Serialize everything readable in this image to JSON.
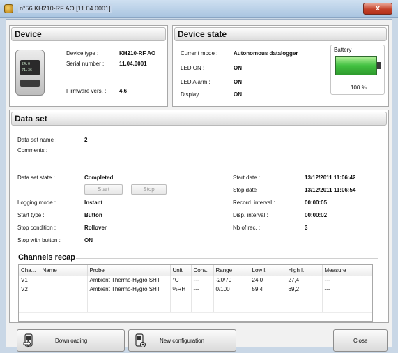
{
  "window": {
    "title": "n°56 KH210-RF AO [11.04.0001]",
    "close_label": "x"
  },
  "device_panel": {
    "heading": "Device",
    "type_label": "Device type :",
    "type_value": "KH210-RF AO",
    "serial_label": "Serial number :",
    "serial_value": "11.04.0001",
    "firmware_label": "Firmware vers. :",
    "firmware_value": "4.6",
    "screen_line1": "24.0",
    "screen_line2": "71.36"
  },
  "state_panel": {
    "heading": "Device state",
    "mode_label": "Current mode :",
    "mode_value": "Autonomous datalogger",
    "led_on_label": "LED ON :",
    "led_on_value": "ON",
    "led_alarm_label": "LED Alarm :",
    "led_alarm_value": "ON",
    "display_label": "Display :",
    "display_value": "ON",
    "battery_label": "Battery",
    "battery_percent_text": "100 %",
    "battery_level": 1.0
  },
  "dataset": {
    "heading": "Data set",
    "name_label": "Data set name :",
    "name_value": "2",
    "comments_label": "Comments :",
    "state_label": "Data set state :",
    "state_value": "Completed",
    "start_btn": "Start",
    "stop_btn": "Stop",
    "logging_label": "Logging mode :",
    "logging_value": "Instant",
    "start_type_label": "Start type :",
    "start_type_value": "Button",
    "stop_cond_label": "Stop condition :",
    "stop_cond_value": "Rollover",
    "stop_button_label": "Stop with button :",
    "stop_button_value": "ON",
    "start_date_label": "Start date :",
    "start_date_value": "13/12/2011 11:06:42",
    "stop_date_label": "Stop date :",
    "stop_date_value": "13/12/2011 11:06:54",
    "record_label": "Record. interval :",
    "record_value": "00:00:05",
    "disp_label": "Disp. interval :",
    "disp_value": "00:00:02",
    "nbrec_label": "Nb of rec. :",
    "nbrec_value": "3"
  },
  "channels": {
    "heading": "Channels recap",
    "columns": [
      "Cha...",
      "Name",
      "Probe",
      "Unit",
      "Conv.",
      "Range",
      "Low l.",
      "High l.",
      "Measure"
    ],
    "rows": [
      [
        "V1",
        "",
        "Ambient Thermo-Hygro SHT",
        "°C",
        "---",
        "-20/70",
        "24,0",
        "27,4",
        "---"
      ],
      [
        "V2",
        "",
        "Ambient Thermo-Hygro SHT",
        "%RH",
        "---",
        "0/100",
        "59,4",
        "69,2",
        "---"
      ]
    ]
  },
  "footer": {
    "download_label": "Downloading",
    "newconf_label": "New configuration",
    "close_label": "Close"
  }
}
